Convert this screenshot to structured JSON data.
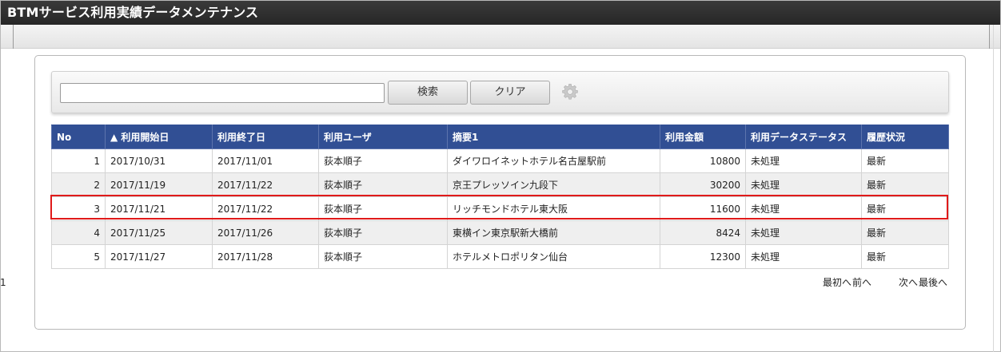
{
  "window": {
    "title": "BTMサービス利用実績データメンテナンス"
  },
  "search": {
    "value": "",
    "placeholder": "",
    "search_label": "検索",
    "clear_label": "クリア"
  },
  "table": {
    "headers": {
      "no": "No",
      "start": "▲ 利用開始日",
      "end": "利用終了日",
      "user": "利用ユーザ",
      "summary": "摘要1",
      "amount": "利用金額",
      "status": "利用データステータス",
      "history": "履歴状況"
    },
    "rows": [
      {
        "no": "1",
        "start": "2017/10/31",
        "end": "2017/11/01",
        "user": "荻本順子",
        "summary": "ダイワロイネットホテル名古屋駅前",
        "amount": "10800",
        "status": "未処理",
        "history": "最新"
      },
      {
        "no": "2",
        "start": "2017/11/19",
        "end": "2017/11/22",
        "user": "荻本順子",
        "summary": "京王プレッソイン九段下",
        "amount": "30200",
        "status": "未処理",
        "history": "最新"
      },
      {
        "no": "3",
        "start": "2017/11/21",
        "end": "2017/11/22",
        "user": "荻本順子",
        "summary": "リッチモンドホテル東大阪",
        "amount": "11600",
        "status": "未処理",
        "history": "最新"
      },
      {
        "no": "4",
        "start": "2017/11/25",
        "end": "2017/11/26",
        "user": "荻本順子",
        "summary": "東横イン東京駅新大橋前",
        "amount": "8424",
        "status": "未処理",
        "history": "最新"
      },
      {
        "no": "5",
        "start": "2017/11/27",
        "end": "2017/11/28",
        "user": "荻本順子",
        "summary": "ホテルメトロポリタン仙台",
        "amount": "12300",
        "status": "未処理",
        "history": "最新"
      }
    ]
  },
  "pager": {
    "first": "最初へ",
    "prev": "前へ",
    "current": "1",
    "next": "次へ",
    "last": "最後へ"
  },
  "colors": {
    "header_bg": "#314f94",
    "highlight": "#e01a1a",
    "titlebar": "#2b2b2b"
  },
  "icons": {
    "settings": "gear-icon"
  }
}
